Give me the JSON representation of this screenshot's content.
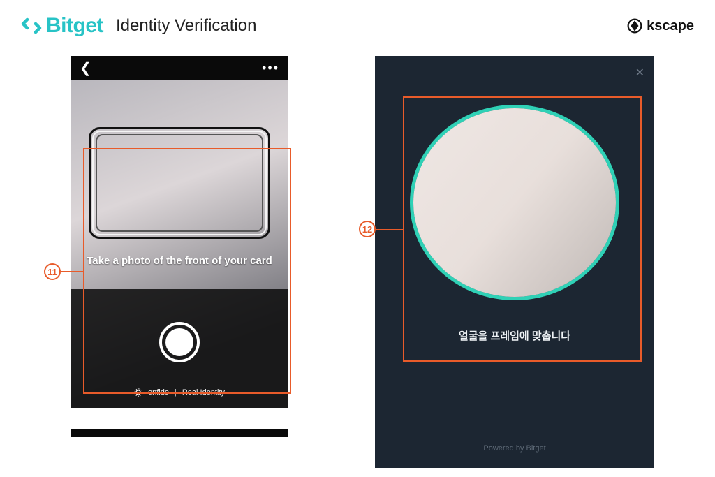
{
  "header": {
    "brand": "Bitget",
    "title": "Identity Verification",
    "rightBrand": "kscape"
  },
  "left": {
    "instruction": "Take a photo of the front of your card",
    "footerBrand": "onfido",
    "footerTag": "Real Identity",
    "callout": "11"
  },
  "right": {
    "instruction": "얼굴을 프레임에 맞춥니다",
    "powered": "Powered by Bitget",
    "callout": "12"
  },
  "colors": {
    "accent": "#28c3c6",
    "callout": "#e85b2a",
    "ovalRing": "#2fd1b6",
    "darkPanel": "#1c2632"
  }
}
